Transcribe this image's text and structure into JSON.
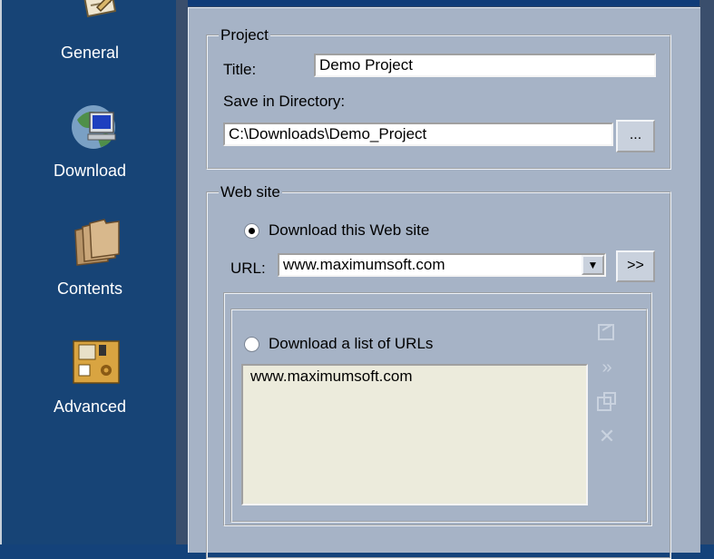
{
  "nav": {
    "items": [
      {
        "label": "General",
        "icon": "general-icon"
      },
      {
        "label": "Download",
        "icon": "download-icon"
      },
      {
        "label": "Contents",
        "icon": "contents-icon"
      },
      {
        "label": "Advanced",
        "icon": "advanced-icon"
      }
    ]
  },
  "project": {
    "legend": "Project",
    "title_label": "Title:",
    "title_value": "Demo Project",
    "dir_label": "Save in Directory:",
    "dir_value": "C:\\Downloads\\Demo_Project",
    "browse_label": "..."
  },
  "website": {
    "legend": "Web site",
    "radio_single_label": "Download this Web site",
    "radio_single_checked": true,
    "url_label": "URL:",
    "url_value": "www.maximumsoft.com",
    "go_label": ">>",
    "radio_list_label": "Download a list of URLs",
    "radio_list_checked": false,
    "url_list_text": "www.maximumsoft.com"
  },
  "colors": {
    "nav_bg": "#174476",
    "panel_bg": "#a6b3c6",
    "frame_dark": "#3a4e6c",
    "list_bg": "#ecebdc"
  }
}
